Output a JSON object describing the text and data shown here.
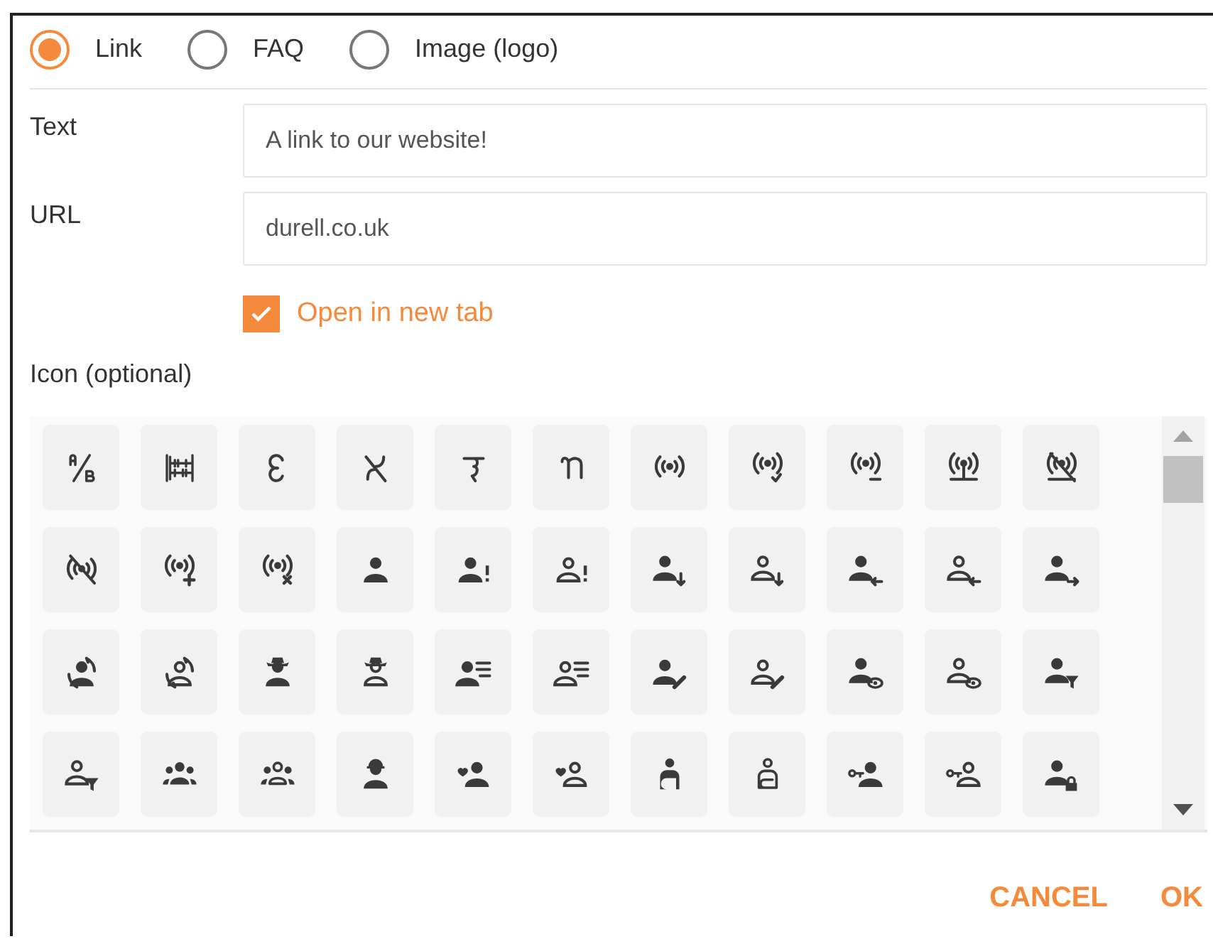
{
  "options": [
    {
      "label": "Link",
      "selected": true
    },
    {
      "label": "FAQ",
      "selected": false
    },
    {
      "label": "Image (logo)",
      "selected": false
    }
  ],
  "fields": [
    {
      "label": "Text",
      "value": "A link to our website!"
    },
    {
      "label": "URL",
      "value": "durell.co.uk"
    }
  ],
  "open_in_new_tab": {
    "label": "Open in new tab",
    "checked": true
  },
  "icon_picker": {
    "label": "Icon (optional)"
  },
  "buttons": [
    {
      "label": "CANCEL"
    },
    {
      "label": "OK"
    }
  ]
}
